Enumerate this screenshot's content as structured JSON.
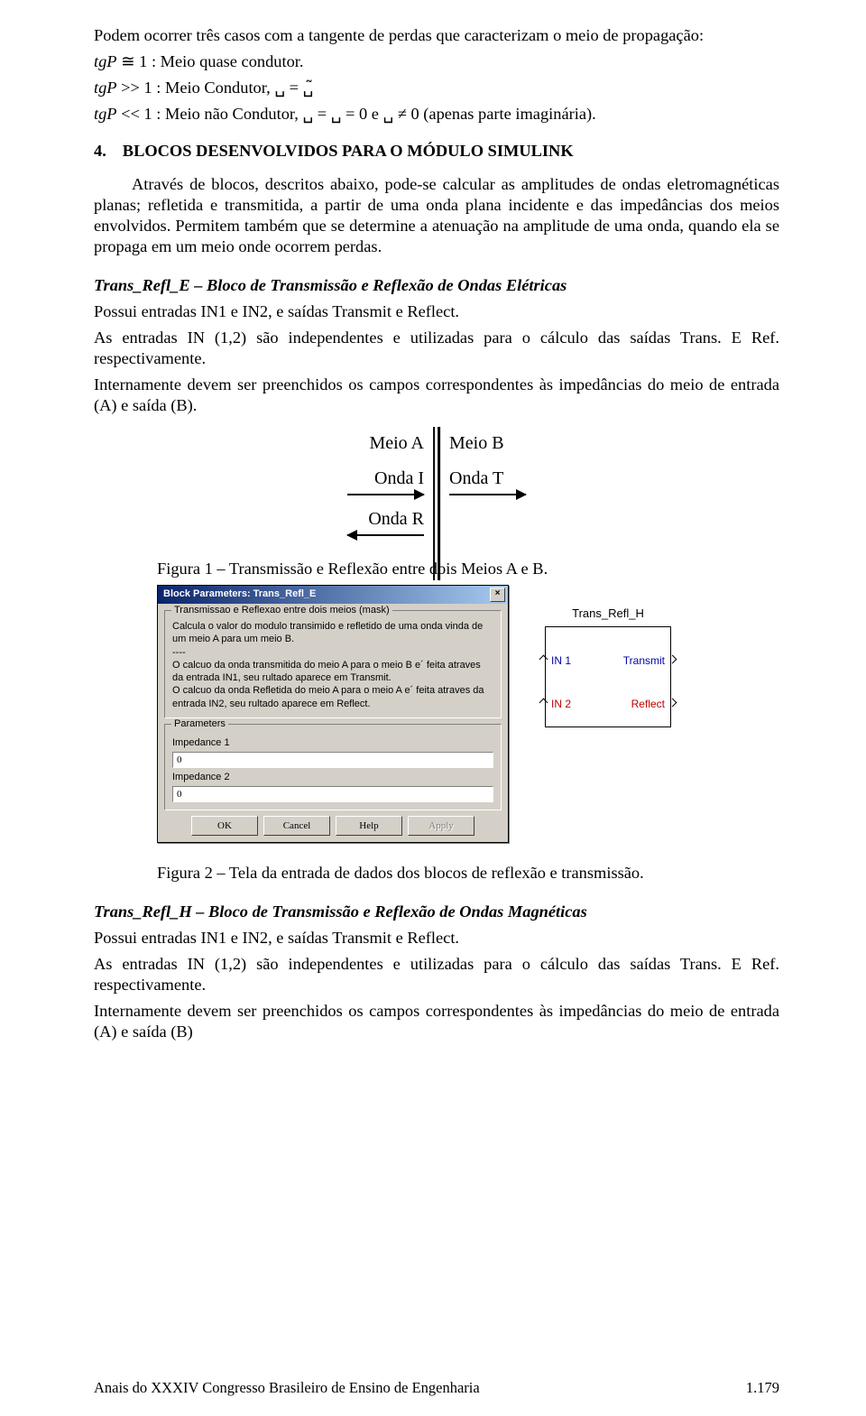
{
  "intro": {
    "p1": "Podem ocorrer três casos com a tangente de perdas que caracterizam o meio de propagação:",
    "line1_pre": "tgP",
    "line1_rest": " ≅ 1 : Meio quase condutor.",
    "line2_pre": "tgP",
    "line2_rest": " >> 1 : Meio Condutor, ␣ = ␣̃",
    "line3_pre": "tgP",
    "line3_rest": " << 1 : Meio não Condutor, ␣ = ␣ = 0 e ␣ ≠ 0 (apenas parte imaginária)."
  },
  "section4": {
    "number": "4.",
    "title": "BLOCOS DESENVOLVIDOS PARA O MÓDULO SIMULINK",
    "p1": "Através de blocos, descritos abaixo, pode-se calcular as amplitudes de ondas eletromagnéticas  planas; refletida e transmitida, a partir de uma onda plana incidente e das impedâncias dos meios envolvidos. Permitem também que se determine a atenuação na amplitude de uma onda, quando ela se propaga em um meio onde ocorrem perdas."
  },
  "trans_refl_e": {
    "heading": "Trans_Refl_E – Bloco de Transmissão e Reflexão de Ondas Elétricas",
    "p1": "Possui entradas IN1 e IN2, e saídas Transmit e Reflect.",
    "p2": "As entradas IN (1,2) são independentes e utilizadas para o cálculo das saídas Trans. E Ref. respectivamente.",
    "p3": "Internamente devem ser preenchidos os campos correspondentes às impedâncias do meio de entrada (A) e saída (B)."
  },
  "fig1": {
    "meioA": "Meio A",
    "meioB": "Meio B",
    "ondaI": "Onda I",
    "ondaT": "Onda T",
    "ondaR": "Onda R",
    "caption": "Figura 1 – Transmissão e Reflexão entre dois Meios A e B."
  },
  "dialog": {
    "title": "Block Parameters: Trans_Refl_E",
    "close": "×",
    "mask_legend": "Transmissao e Reflexao entre dois meios (mask)",
    "mask_desc": "Calcula o valor do modulo transimido e refletido de uma onda vinda de um meio A para um meio B.\n----\nO calcuo da onda transmitida do meio A para o meio B e´ feita atraves da entrada IN1, seu rultado aparece em Transmit.\nO calcuo da onda Refletida do meio A para o meio A e´ feita atraves da entrada IN2, seu rultado aparece em Reflect.",
    "params_legend": "Parameters",
    "imp1_label": "Impedance 1",
    "imp1_value": "0",
    "imp2_label": "Impedance 2",
    "imp2_value": "0",
    "ok": "OK",
    "cancel": "Cancel",
    "help": "Help",
    "apply": "Apply"
  },
  "simblock": {
    "title": "Trans_Refl_H",
    "in1": "IN 1",
    "in2": "IN 2",
    "out1": "Transmit",
    "out2": "Reflect"
  },
  "fig2_caption": "Figura 2 – Tela da entrada de dados dos blocos de reflexão e transmissão.",
  "trans_refl_h": {
    "heading": "Trans_Refl_H – Bloco de Transmissão e Reflexão de Ondas Magnéticas",
    "p1": "Possui entradas IN1 e IN2, e saídas Transmit e Reflect.",
    "p2": "As entradas IN (1,2) são independentes e utilizadas para o cálculo das saídas Trans. E Ref. respectivamente.",
    "p3": "Internamente devem ser preenchidos os campos correspondentes às impedâncias do meio de entrada (A) e saída (B)"
  },
  "footer": {
    "left": "Anais do XXXIV Congresso Brasileiro de Ensino de Engenharia",
    "right": "1.179"
  }
}
